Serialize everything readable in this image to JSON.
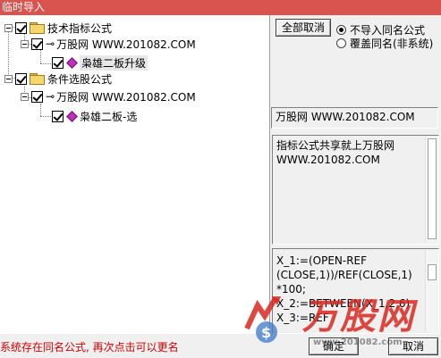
{
  "window": {
    "title": "临时导入"
  },
  "tree": {
    "nodes": [
      {
        "label": "技术指标公式"
      },
      {
        "label": "万股网 WWW.201082.COM"
      },
      {
        "label": "枭雄二板升级"
      },
      {
        "label": "条件选股公式"
      },
      {
        "label": "万股网 WWW.201082.COM"
      },
      {
        "label": "枭雄二板-选"
      }
    ]
  },
  "options": {
    "deselect_all_label": "全部取消",
    "radio_skip_label": "不导入同名公式",
    "radio_overwrite_label": "覆盖同名(非系统)"
  },
  "info": {
    "author": "万股网 WWW.201082.COM",
    "description_line1": "指标公式共享就上万股网",
    "description_line2": "WWW.201082.COM",
    "code_lines": [
      "X_1:=(OPEN-REF",
      "(CLOSE,1))/REF(CLOSE,1)",
      "*100;",
      "X_2:=BETWEEN(X_1,2,6)",
      "X_3:=REF"
    ]
  },
  "footer": {
    "status_message": "系统存在同名公式, 再次点击可以更名",
    "ok_label": "确定",
    "cancel_label": "取消"
  },
  "watermark": {
    "brand": "万股网",
    "url": "www.201082.com"
  },
  "colors": {
    "titlebar": "#d9534f",
    "status_text": "#d00000",
    "watermark_red": "#d7281e"
  }
}
